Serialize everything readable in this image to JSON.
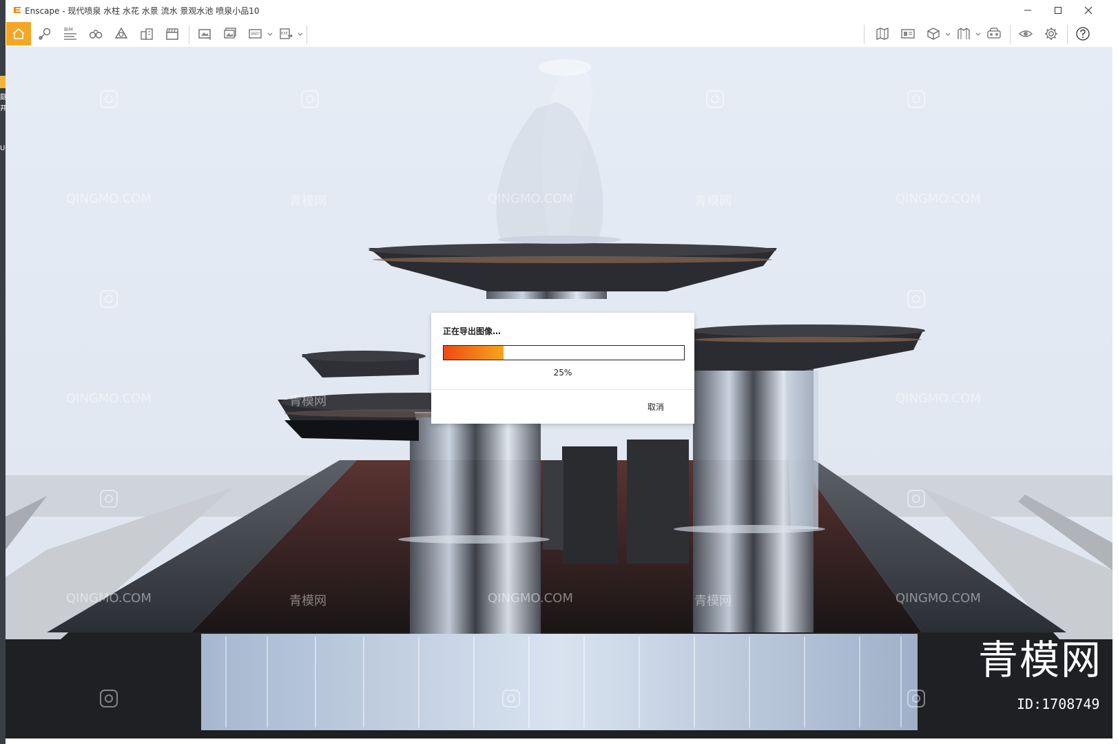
{
  "window": {
    "title": "Enscape - 现代喷泉 水柱 水花 水景 流水 景观水池 喷泉小品10",
    "controls": [
      "minimize",
      "maximize",
      "close"
    ]
  },
  "left_strip": {
    "fragments": [
      "庭",
      "井",
      "U"
    ]
  },
  "toolbar": {
    "left_icons": [
      "home-icon",
      "map-pin-icon",
      "bim-icon",
      "binoculars-icon",
      "assets-icon",
      "buildings-icon",
      "clapperboard-icon",
      "screenshot-icon",
      "batch-render-icon",
      "panorama-360-icon",
      "export-exe-icon"
    ],
    "bim_label": "BIM",
    "pano_label": "360°",
    "exe_label": "EXE",
    "right_icons": [
      "map-view-icon",
      "views-icon",
      "cube-icon",
      "materials-icon",
      "vr-headset-icon",
      "visual-settings-icon",
      "settings-icon",
      "help-icon"
    ],
    "accent": "#f5a623"
  },
  "dialog": {
    "title": "正在导出图像…",
    "progress": 25,
    "progress_label": "25%",
    "cancel_label": "取消",
    "fill_colors": [
      "#ef4a14",
      "#f7a51b"
    ]
  },
  "watermark": {
    "text_cn": "青模网",
    "text_en": "QINGMO.COM",
    "brand": "青模网",
    "id": "ID:1708749"
  }
}
